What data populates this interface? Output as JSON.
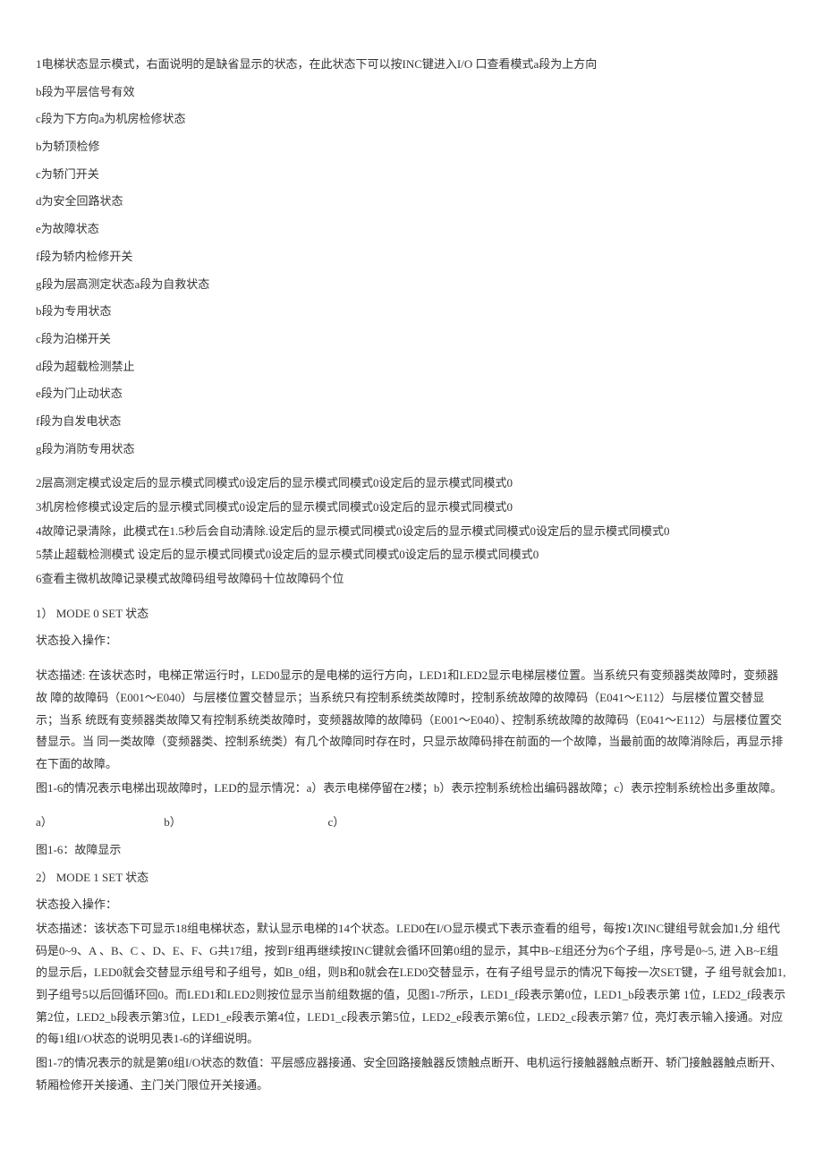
{
  "l1": "1电梯状态显示模式，右面说明的是缺省显示的状态，在此状态下可以按INC键进入I/O 口查看模式a段为上方向",
  "l2": "b段为平层信号有效",
  "l3": "c段为下方向a为机房检修状态",
  "l4": "b为轿顶检修",
  "l5": "c为轿门开关",
  "l6": "d为安全回路状态",
  "l7": "e为故障状态",
  "l8": "f段为轿内检修开关",
  "l9": "g段为层高测定状态a段为自救状态",
  "l10": "b段为专用状态",
  "l11": "c段为泊梯开关",
  "l12": "d段为超载检测禁止",
  "l13": "e段为门止动状态",
  "l14": "f段为自发电状态",
  "l15": "g段为消防专用状态",
  "m1": "2层高测定模式设定后的显示模式同模式0设定后的显示模式同模式0设定后的显示模式同模式0",
  "m2": "3机房检修模式设定后的显示模式同模式0设定后的显示模式同模式0设定后的显示模式同模式0",
  "m3": "4故障记录清除，此模式在1.5秒后会自动清除.设定后的显示模式同模式0设定后的显示模式同模式0设定后的显示模式同模式0",
  "m4": "5禁止超载检测模式  设定后的显示模式同模式0设定后的显示模式同模式0设定后的显示模式同模式0",
  "m5": "6查看主微机故障记录模式故障码组号故障码十位故障码个位",
  "s1_title": "1）  MODE 0 SET 状态",
  "s1_op": "状态投入操作：",
  "s1_p1": "状态描述:  在该状态时，电梯正常运行时，LED0显示的是电梯的运行方向，LED1和LED2显示电梯层楼位置。当系统只有变频器类故障时，变频器故  障的故障码（E001～E040）与层楼位置交替显示；当系统只有控制系统类故障时，控制系统故障的故障码（E041～E112）与层楼位置交替显示；当系  统既有变频器类故障又有控制系统类故障时，变频器故障的故障码（E001～E040）、控制系统故障的故障码（E041～E112）与层楼位置交替显示。当  同一类故障（变频器类、控制系统类）有几个故障同时存在时，只显示故障码排在前面的一个故障，当最前面的故障消除后，再显示排在下面的故障。",
  "s1_p2": "图1-6的情况表示电梯出现故障时，LED的显示情况：a）表示电梯停留在2楼；b）表示控制系统检出编码器故障；c）表示控制系统检出多重故障。",
  "abc_a": "a）",
  "abc_b": "b）",
  "abc_c": "c）",
  "fig1": "图1-6：故障显示",
  "s2_title": "2）  MODE 1 SET 状态",
  "s2_op": "状态投入操作：",
  "s2_p1": "状态描述：该状态下可显示18组电梯状态，默认显示电梯的14个状态。LED0在I/O显示模式下表示查看的组号，每按1次INC键组号就会加1,分   组代码是0~9、A 、B、C 、D、E、F、G共17组，按到F组再继续按INC键就会循环回第0组的显示，其中B~E组还分为6个子组，序号是0~5, 进   入B~E组的显示后，LED0就会交替显示组号和子组号，如B_0组，则B和0就会在LED0交替显示，在有子组号显示的情况下每按一次SET键，子   组号就会加1, 到子组号5以后回循环回0。而LED1和LED2则按位显示当前组数据的值，见图1-7所示，LED1_f段表示第0位，LED1_b段表示第  1位，LED2_f段表示第2位，LED2_b段表示第3位，LED1_e段表示第4位，LED1_c段表示第5位，LED2_e段表示第6位，LED2_c段表示第7 位，亮灯表示输入接通。对应的每1组I/O状态的说明见表1-6的详细说明。",
  "s2_p2": "图1-7的情况表示的就是第0组I/O状态的数值：平层感应器接通、安全回路接触器反馈触点断开、电机运行接触器触点断开、轿门接触器触点断开、  轿厢检修开关接通、主门关门限位开关接通。"
}
